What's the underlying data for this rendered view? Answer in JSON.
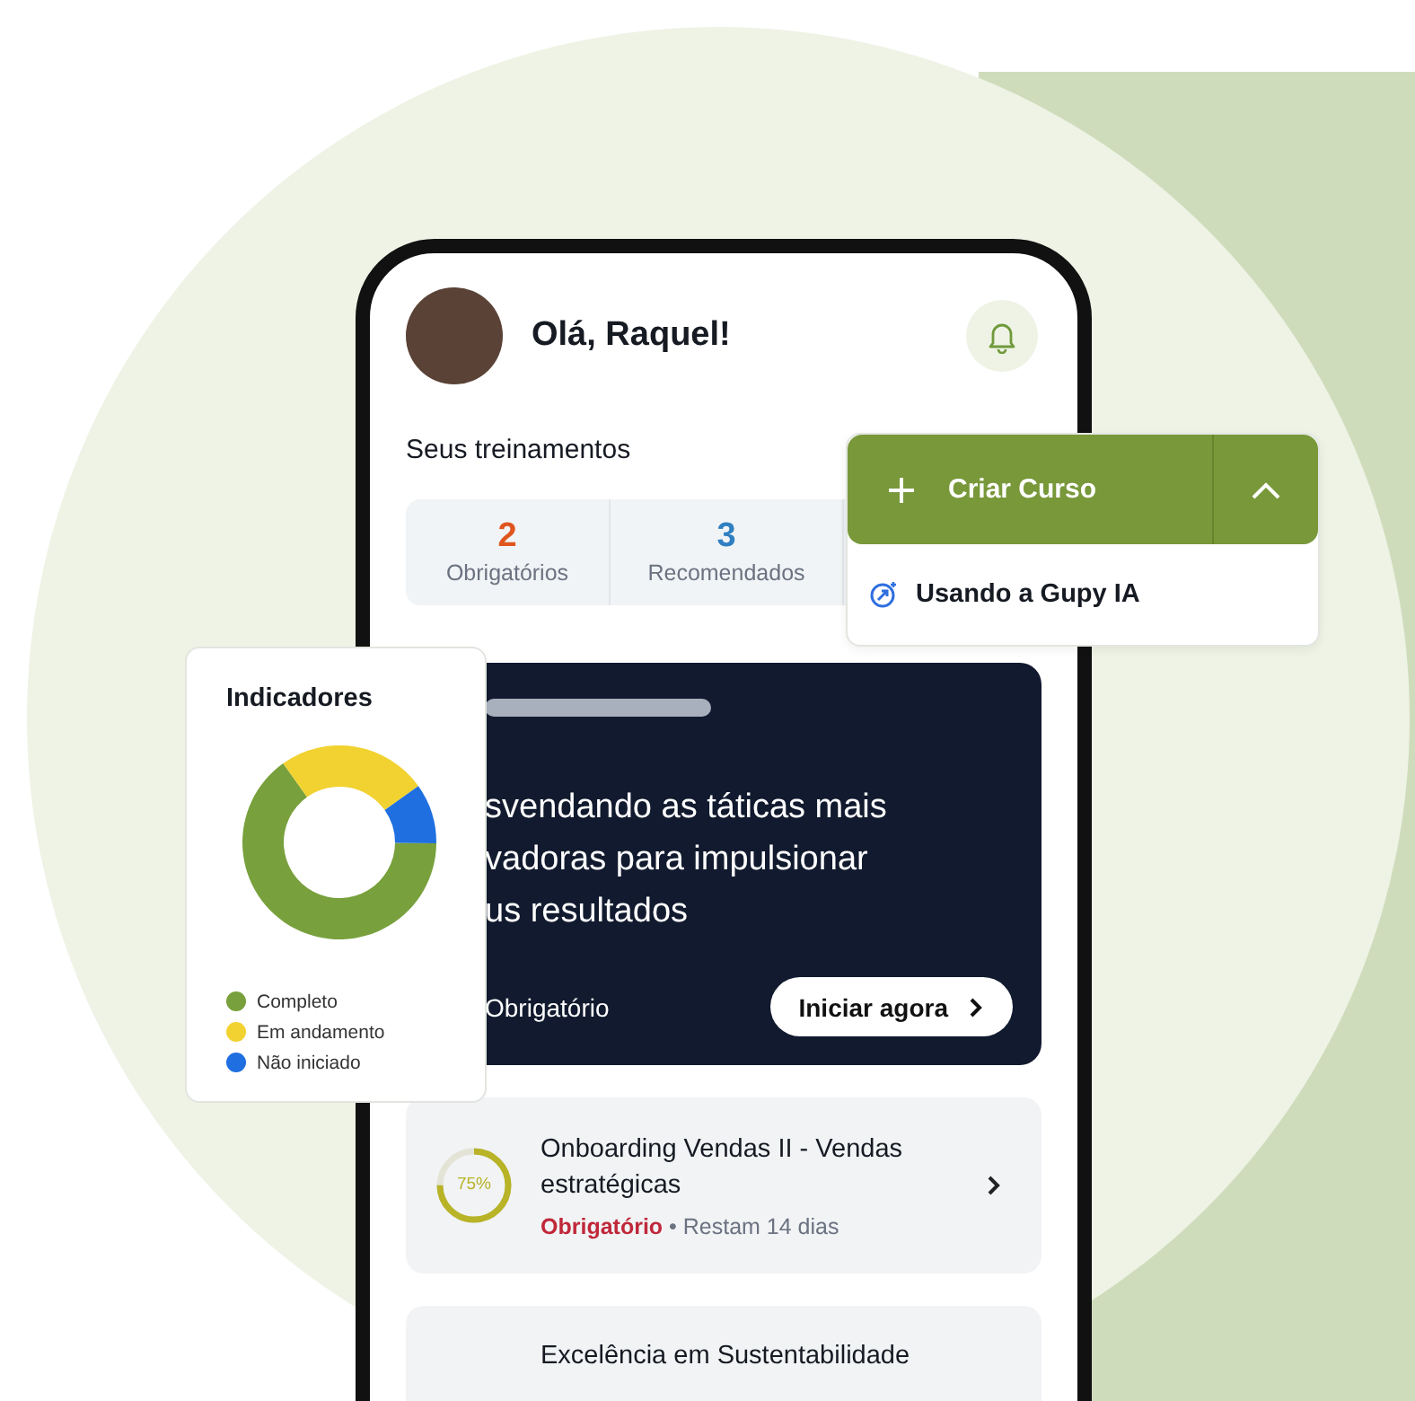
{
  "profile": {
    "greeting": "Olá, Raquel!"
  },
  "trainings": {
    "title": "Seus treinamentos",
    "stats": [
      {
        "value": "2",
        "label": "Obrigatórios",
        "color": "#e0551f"
      },
      {
        "value": "3",
        "label": "Recomendados",
        "color": "#2f7fc1"
      }
    ]
  },
  "featured": {
    "title_lines": [
      "svendando as táticas mais",
      "vadoras para impulsionar",
      "us resultados"
    ],
    "tag": "Obrigatório",
    "button": "Iniciar agora"
  },
  "courses": [
    {
      "title": "Onboarding Vendas II - Vendas estratégicas",
      "progress": "75%",
      "level": 0.75,
      "tag": "Obrigatório",
      "meta": "• Restam 14 dias"
    },
    {
      "title": "Excelência em Sustentabilidade"
    }
  ],
  "create_menu": {
    "button": "Criar Curso",
    "expanded": true,
    "options": [
      "Usando a Gupy IA"
    ]
  },
  "indicators": {
    "title": "Indicadores",
    "legend": [
      {
        "label": "Completo",
        "color": "#78a03c"
      },
      {
        "label": "Em andamento",
        "color": "#f2d230"
      },
      {
        "label": "Não iniciado",
        "color": "#1f6fe0"
      }
    ]
  }
}
